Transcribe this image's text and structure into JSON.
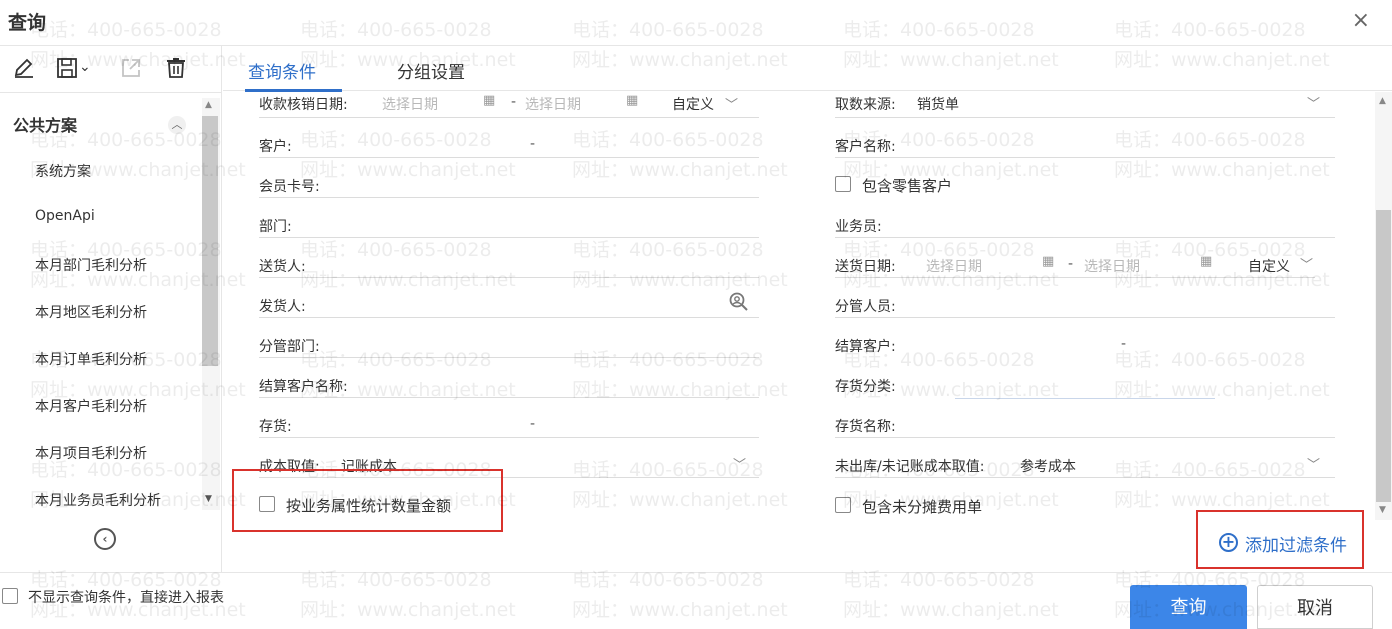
{
  "window": {
    "title": "查询",
    "close_glyph": "×"
  },
  "watermark": {
    "phone": "电话：400-665-0028",
    "site": "网址：www.chanjet.net"
  },
  "toolbar": {
    "edit_icon": "edit-icon",
    "save_icon": "save-icon",
    "export_icon": "export-icon",
    "delete_icon": "delete-icon",
    "save_dropdown": "⌄"
  },
  "sidebar": {
    "group_label": "公共方案",
    "items": [
      {
        "label": "系统方案"
      },
      {
        "label": "OpenApi"
      },
      {
        "label": "本月部门毛利分析"
      },
      {
        "label": "本月地区毛利分析"
      },
      {
        "label": "本月订单毛利分析"
      },
      {
        "label": "本月客户毛利分析"
      },
      {
        "label": "本月项目毛利分析"
      },
      {
        "label": "本月业务员毛利分析"
      }
    ]
  },
  "tabs": [
    {
      "label": "查询条件",
      "active": true
    },
    {
      "label": "分组设置",
      "active": false
    }
  ],
  "form": {
    "left": {
      "writeoff_date": {
        "label": "收款核销日期:",
        "start_placeholder": "选择日期",
        "end_placeholder": "选择日期",
        "range_sep": "-",
        "mode": "自定义"
      },
      "customer": {
        "label": "客户:",
        "range_sep": "-"
      },
      "member_card": {
        "label": "会员卡号:"
      },
      "department": {
        "label": "部门:"
      },
      "delivery_person": {
        "label": "送货人:"
      },
      "shipper": {
        "label": "发货人:"
      },
      "managing_dept": {
        "label": "分管部门:"
      },
      "settle_customer_name": {
        "label": "结算客户名称:"
      },
      "inventory": {
        "label": "存货:",
        "range_sep": "-"
      },
      "cost_value": {
        "label": "成本取值:",
        "value": "记账成本"
      },
      "stat_by_business_attr": {
        "label": "按业务属性统计数量金额",
        "checked": false
      }
    },
    "right": {
      "data_source": {
        "label": "取数来源:",
        "value": "销货单"
      },
      "customer_name": {
        "label": "客户名称:"
      },
      "include_retail": {
        "label": "包含零售客户",
        "checked": false
      },
      "salesperson": {
        "label": "业务员:"
      },
      "delivery_date": {
        "label": "送货日期:",
        "start_placeholder": "选择日期",
        "end_placeholder": "选择日期",
        "range_sep": "-",
        "mode": "自定义"
      },
      "manager": {
        "label": "分管人员:"
      },
      "settle_customer": {
        "label": "结算客户:",
        "range_sep": "-"
      },
      "inventory_category": {
        "label": "存货分类:"
      },
      "inventory_name": {
        "label": "存货名称:"
      },
      "unshipped_cost": {
        "label": "未出库/未记账成本取值:",
        "value": "参考成本"
      },
      "include_unallocated": {
        "label": "包含未分摊费用单",
        "checked": false
      }
    },
    "add_filter": "添加过滤条件"
  },
  "footer": {
    "skip_conditions_label": "不显示查询条件，直接进入报表",
    "skip_conditions_checked": false,
    "query_button": "查询",
    "cancel_button": "取消"
  },
  "colors": {
    "accent": "#2f6fc9",
    "primary_button": "#3c86e8",
    "highlight_box": "#d9322c"
  }
}
